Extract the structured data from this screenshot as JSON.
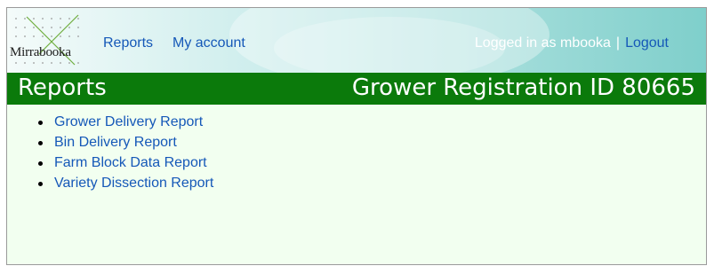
{
  "header": {
    "logo_text": "Mirrabooka",
    "nav": [
      "Reports",
      "My account"
    ],
    "login_text": "Logged in as mbooka",
    "separator": "|",
    "logout_label": "Logout"
  },
  "title_bar": {
    "left": "Reports",
    "right": "Grower Registration ID 80665"
  },
  "reports": [
    "Grower Delivery Report",
    "Bin Delivery Report",
    "Farm Block Data Report",
    "Variety Dissection Report"
  ],
  "colors": {
    "green_bar": "#0b7a0b",
    "link": "#1558b8",
    "content_bg": "#f2fff0"
  }
}
